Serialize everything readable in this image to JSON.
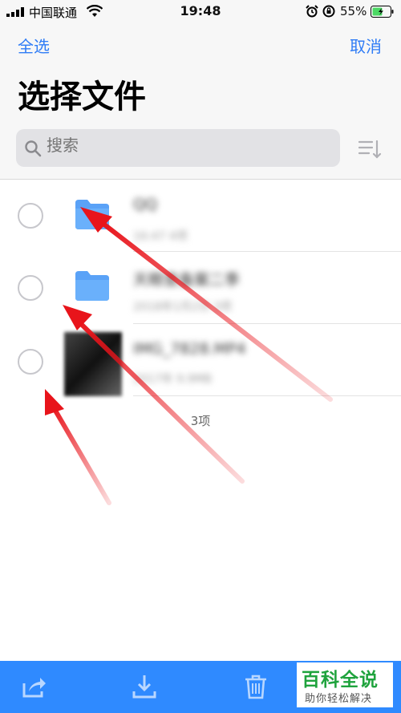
{
  "status": {
    "carrier": "中国联通",
    "time": "19:48",
    "battery_percent": "55%"
  },
  "nav": {
    "select_all": "全选",
    "cancel": "取消",
    "title": "选择文件"
  },
  "search": {
    "placeholder": "搜索"
  },
  "files": [
    {
      "name": "QQ",
      "meta": "16:47 4项",
      "type": "folder"
    },
    {
      "name": "天眼查备案二季",
      "meta": "2018年1月2日 3项",
      "type": "folder"
    },
    {
      "name": "IMG_7828.MP4",
      "meta": "2017年 9.9MB",
      "type": "video"
    }
  ],
  "count_label": "3项",
  "watermark": {
    "title": "百科全说",
    "subtitle": "助你轻松解决"
  },
  "colors": {
    "accent": "#2f7cf6",
    "toolbar": "#2f8aff",
    "arrow": "#e8141b",
    "battery": "#4cd964",
    "watermark_green": "#1fa33d"
  }
}
